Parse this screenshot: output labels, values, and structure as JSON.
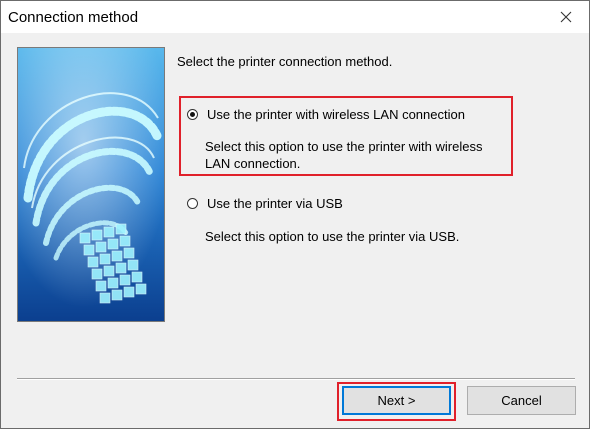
{
  "window": {
    "title": "Connection method",
    "close_icon": "close-icon"
  },
  "illustration": {
    "icon": "wireless-spiral-illustration",
    "colors": {
      "top": "#59b8ec",
      "bottom": "#0b3f8f",
      "glow": "#9ff3ff"
    }
  },
  "prompt": "Select the printer connection method.",
  "options": [
    {
      "label": "Use the printer with wireless LAN connection",
      "description": "Select this option to use the printer with wireless LAN connection.",
      "selected": true
    },
    {
      "label": "Use the printer via USB",
      "description": "Select this option to use the printer via USB.",
      "selected": false
    }
  ],
  "buttons": {
    "next": "Next >",
    "cancel": "Cancel"
  },
  "highlight_color": "#e0202a"
}
